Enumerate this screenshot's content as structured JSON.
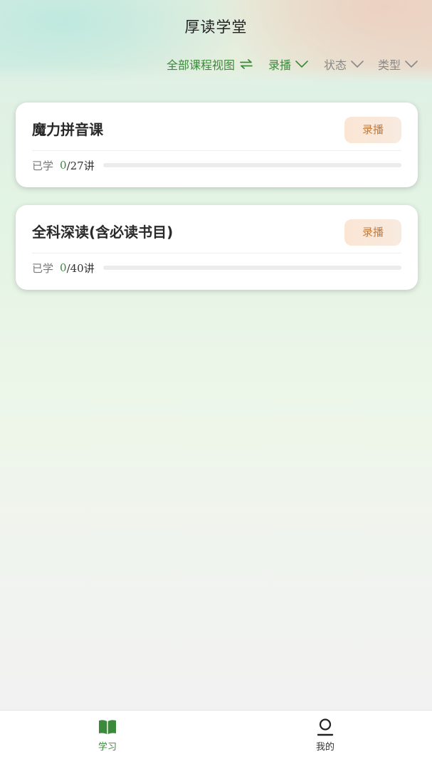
{
  "header": {
    "title": "厚读学堂"
  },
  "filters": {
    "view_label": "全部课程视图",
    "record_label": "录播",
    "status_label": "状态",
    "type_label": "类型"
  },
  "courses": [
    {
      "title": "魔力拼音课",
      "badge": "录播",
      "learned_label": "已学",
      "completed": "0",
      "total_suffix": "/27讲",
      "progress": 0
    },
    {
      "title": "全科深读(含必读书目)",
      "badge": "录播",
      "learned_label": "已学",
      "completed": "0",
      "total_suffix": "/40讲",
      "progress": 0
    }
  ],
  "tabbar": {
    "items": [
      {
        "label": "学习",
        "icon": "open-book-icon",
        "active": true
      },
      {
        "label": "我的",
        "icon": "user-icon",
        "active": false
      }
    ]
  },
  "colors": {
    "accent_green": "#3b8a3b",
    "badge_text": "#c07c42",
    "badge_bg": "#fbe6d4"
  }
}
